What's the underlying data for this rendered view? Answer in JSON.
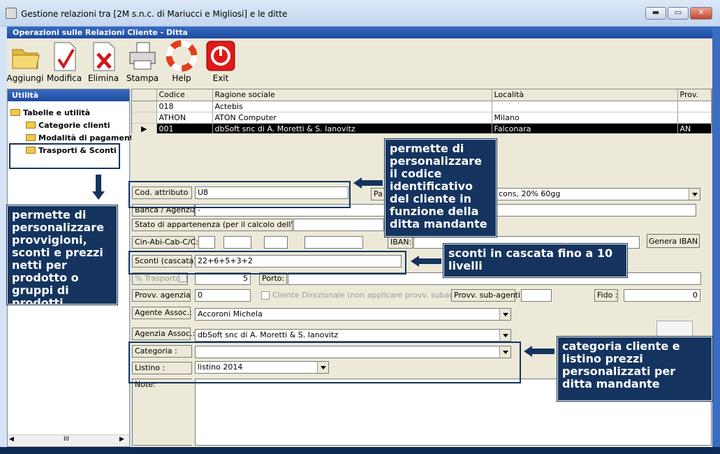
{
  "window": {
    "title": "Gestione relazioni tra [2M s.n.c. di Mariucci e Migliosi] e le ditte",
    "min": "▬",
    "max": "▭",
    "close": "✕"
  },
  "subtitle": "Operazioni sulle Relazioni Cliente - Ditta",
  "toolbar": [
    {
      "label": "Aggiungi",
      "icon": "folder-icon"
    },
    {
      "label": "Modifica",
      "icon": "edit-document-icon"
    },
    {
      "label": "Elimina",
      "icon": "delete-document-icon"
    },
    {
      "label": "Stampa",
      "icon": "printer-icon"
    },
    {
      "label": "Help",
      "icon": "lifebuoy-icon"
    },
    {
      "label": "Exit",
      "icon": "exit-icon"
    }
  ],
  "sidebar": {
    "header": "Utilità",
    "root": "Tabelle e utilità",
    "items": [
      "Categorie clienti",
      "Modalità di pagamento",
      "Trasporti & Sconti"
    ],
    "scroll_mark": "III"
  },
  "grid": {
    "columns": [
      "Codice",
      "Ragione sociale",
      "Località",
      "Prov."
    ],
    "rows": [
      {
        "marker": "",
        "cells": [
          "018",
          "Actebis",
          "",
          ""
        ]
      },
      {
        "marker": "",
        "cells": [
          "ATHON",
          "ATON Computer",
          "Milano",
          ""
        ]
      },
      {
        "marker": "▶",
        "cells": [
          "001",
          "dbSoft snc di A. Moretti & S. Ianovitz",
          "Falconara",
          "AN"
        ]
      }
    ]
  },
  "form": {
    "cod_attributo_label": "Cod. attributo",
    "cod_attributo_value": "U8",
    "pag_label": "Pa",
    "pag_value": "cons, 20% 60gg",
    "banca_label": "Banca / Agenzia",
    "banca_value": "-",
    "stato_label": "Stato di appartenenza (per il calcolo dell' IBAN)",
    "cin_label": "Cin-Abi-Cab-C/C:",
    "iban_label": "IBAN:",
    "genera_iban": "Genera IBAN",
    "sconti_label": "Sconti (cascata)",
    "sconti_value": "22+6+5+3+2",
    "trasporto_label": "% Trasporto",
    "trasporto_value": "5",
    "porto_label": "Porto:",
    "provv_label": "Provv. agenzia",
    "provv_value": "0",
    "cliente_dir_label": "Cliente Direzionale (non applicare provv. subagenti )",
    "provv_sub_label": "Provv. sub-agenti",
    "fido_label": "Fido :",
    "fido_value": "0",
    "agente_label": "Agente Assoc.:",
    "agente_value": "Accoroni Michela",
    "agenzia_label": "Agenzia Assoc.:",
    "agenzia_value": "dbSoft snc di A. Moretti & S. Ianovitz",
    "categoria_label": "Categoria :",
    "categoria_value": "",
    "listino_label": "Listino :",
    "listino_value": "listino 2014",
    "note_label": "Note:"
  },
  "callouts": {
    "left": "permette di personalizzare provvigioni, sconti e prezzi netti per prodotto o gruppi di prodotti",
    "codice": "permette di personalizzare il codice identificativo del cliente in funzione della ditta  mandante",
    "sconti": "sconti in cascata fino a 10 livelli",
    "categoria": "categoria cliente e listino prezzi personalizzati per ditta mandante"
  },
  "colors": {
    "accent": "#1c4aa0",
    "callout": "#14345f",
    "toolbar": "#ece9d8"
  }
}
